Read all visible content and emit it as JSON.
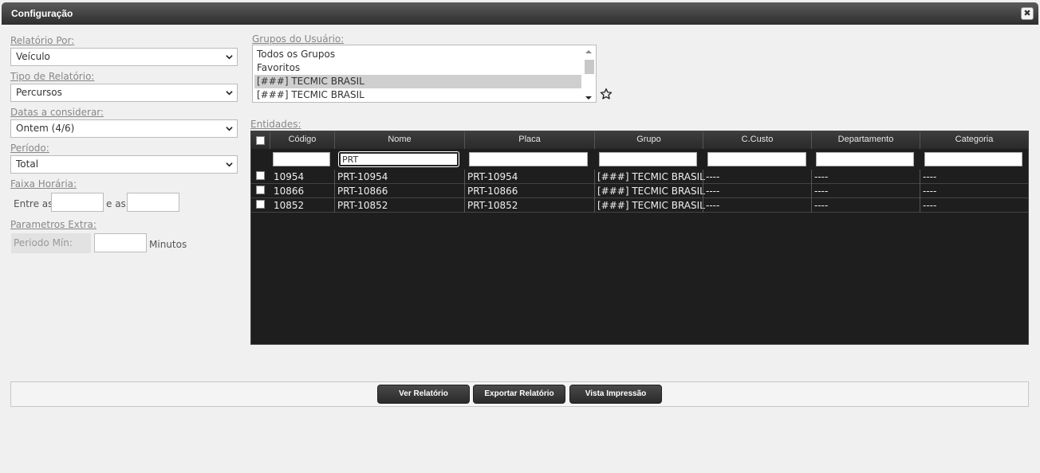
{
  "window": {
    "title": "Configuração"
  },
  "form": {
    "relatorio_por": {
      "label": "Relatório Por:",
      "value": "Veículo"
    },
    "tipo_relatorio": {
      "label": "Tipo de Relatório:",
      "value": "Percursos"
    },
    "datas": {
      "label": "Datas a considerar:",
      "value": "Ontem (4/6)"
    },
    "periodo": {
      "label": "Período:",
      "value": "Total"
    },
    "faixa": {
      "label": "Faixa Horária:",
      "entre": "Entre as",
      "e_as": "e as",
      "start": "",
      "end": ""
    },
    "extra": {
      "label": "Parametros Extra:",
      "periodo_min": "Periodo Mín:",
      "value": "",
      "unit": "Minutos"
    }
  },
  "grupos": {
    "label": "Grupos do Usuário:",
    "items": [
      "Todos os Grupos",
      "Favoritos",
      "[###] TECMIC BRASIL",
      "[###] TECMIC BRASIL"
    ],
    "selected_index": 2
  },
  "entidades": {
    "label": "Entidades:",
    "columns": [
      "Código",
      "Nome",
      "Placa",
      "Grupo",
      "C.Custo",
      "Departamento",
      "Categoria"
    ],
    "filters": [
      "",
      "PRT",
      "",
      "",
      "",
      "",
      ""
    ],
    "rows": [
      [
        "10954",
        "PRT-10954",
        "PRT-10954",
        "[###] TECMIC BRASIL",
        "----",
        "----",
        "----"
      ],
      [
        "10866",
        "PRT-10866",
        "PRT-10866",
        "[###] TECMIC BRASIL",
        "----",
        "----",
        "----"
      ],
      [
        "10852",
        "PRT-10852",
        "PRT-10852",
        "[###] TECMIC BRASIL",
        "----",
        "----",
        "----"
      ]
    ]
  },
  "buttons": {
    "ver": "Ver Relatório",
    "exportar": "Exportar Relatório",
    "vista": "Vista Impressão"
  }
}
